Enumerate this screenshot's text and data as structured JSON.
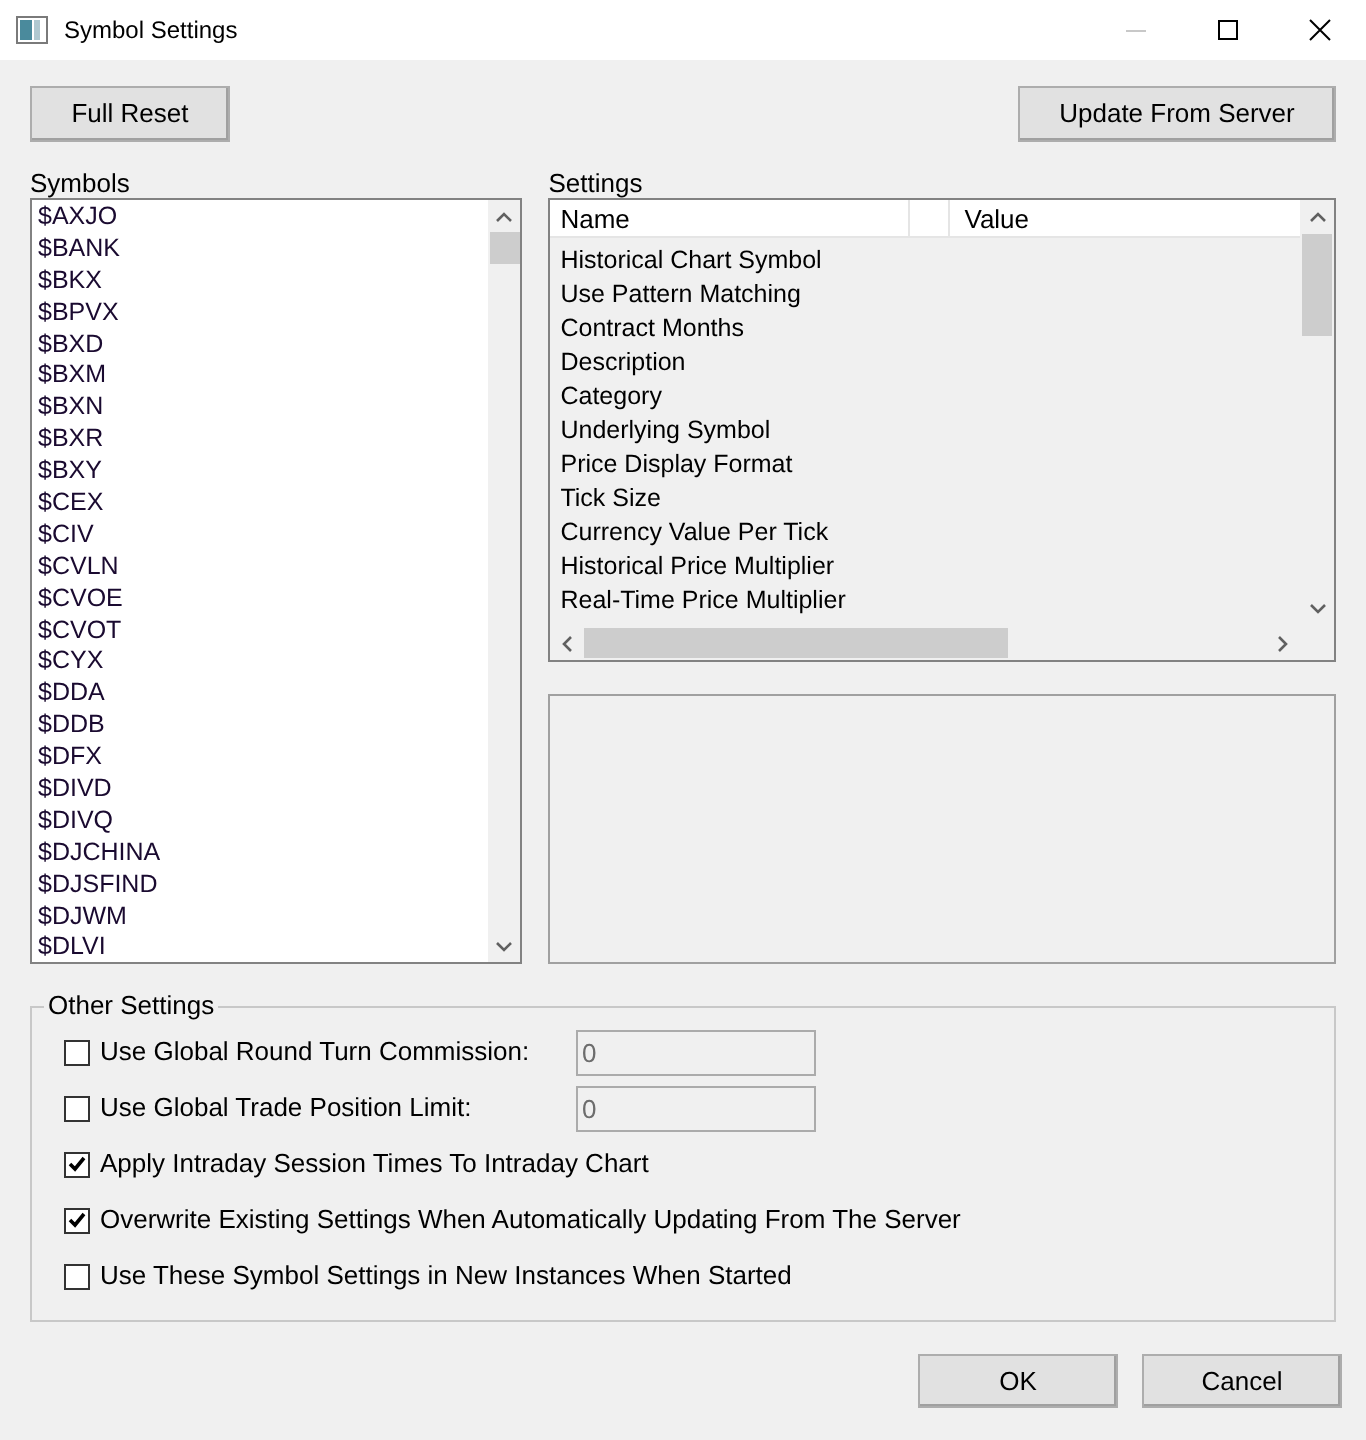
{
  "window": {
    "title": "Symbol Settings"
  },
  "top_buttons": [
    "Full Reset",
    "Update From Server"
  ],
  "symbols": {
    "label": "Symbols",
    "items": [
      "$AXJO",
      "$BANK",
      "$BKX",
      "$BPVX",
      "$BXD",
      "$BXM",
      "$BXN",
      "$BXR",
      "$BXY",
      "$CEX",
      "$CIV",
      "$CVLN",
      "$CVOE",
      "$CVOT",
      "$CYX",
      "$DDA",
      "$DDB",
      "$DFX",
      "$DIVD",
      "$DIVQ",
      "$DJCHINA",
      "$DJSFIND",
      "$DJWM",
      "$DLVI"
    ]
  },
  "settings": {
    "label": "Settings",
    "columns": [
      "Name",
      "Value"
    ],
    "rows": [
      "Historical Chart Symbol",
      "Use Pattern Matching",
      "Contract Months",
      "Description",
      "Category",
      "Underlying Symbol",
      "Price Display Format",
      "Tick Size",
      "Currency Value Per Tick",
      "Historical Price Multiplier",
      "Real-Time Price Multiplier"
    ]
  },
  "other_settings": {
    "label": "Other Settings",
    "options": [
      {
        "kind": "field",
        "label": "Use Global Round Turn Commission:",
        "checked": false,
        "value": "0"
      },
      {
        "kind": "field",
        "label": "Use Global Trade Position Limit:",
        "checked": false,
        "value": "0"
      },
      {
        "kind": "check",
        "label": "Apply Intraday Session Times To Intraday Chart",
        "checked": true
      },
      {
        "kind": "check",
        "label": "Overwrite Existing Settings When Automatically Updating From The Server",
        "checked": true
      },
      {
        "kind": "check",
        "label": "Use These Symbol Settings in New Instances When Started",
        "checked": false
      }
    ]
  },
  "buttons": [
    "OK",
    "Cancel"
  ]
}
